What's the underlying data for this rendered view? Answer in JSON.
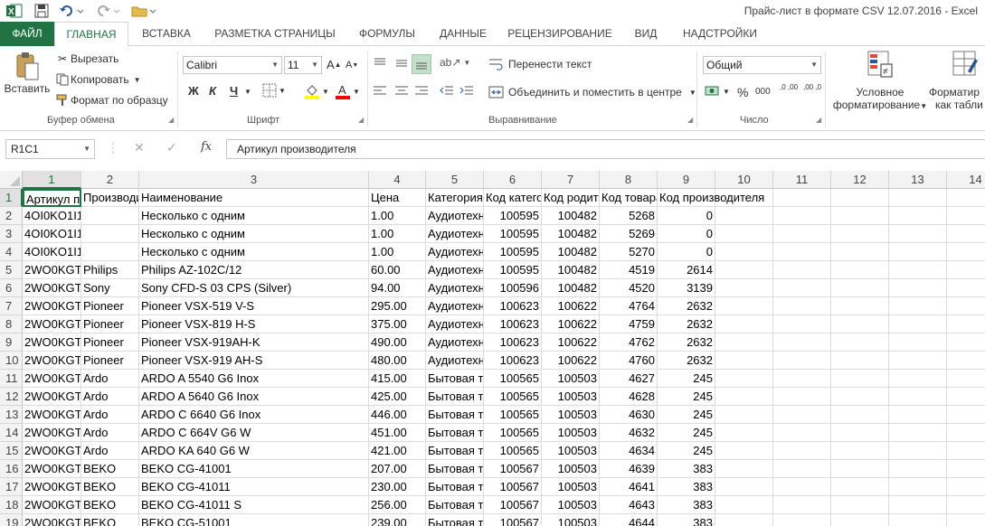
{
  "app": {
    "title": "Прайс-лист в формате CSV 12.07.2016 - Excel",
    "accent": "#217346"
  },
  "tabs": [
    "ФАЙЛ",
    "ГЛАВНАЯ",
    "ВСТАВКА",
    "РАЗМЕТКА СТРАНИЦЫ",
    "ФОРМУЛЫ",
    "ДАННЫЕ",
    "РЕЦЕНЗИРОВАНИЕ",
    "ВИД",
    "НАДСТРОЙКИ"
  ],
  "ribbon": {
    "clipboard": {
      "paste": "Вставить",
      "cut": "Вырезать",
      "copy": "Копировать",
      "format_painter": "Формат по образцу",
      "group": "Буфер обмена"
    },
    "font": {
      "name": "Calibri",
      "size": "11",
      "bold": "Ж",
      "italic": "К",
      "underline": "Ч",
      "group": "Шрифт"
    },
    "alignment": {
      "wrap_text": "Перенести текст",
      "merge_center": "Объединить и поместить в центре",
      "group": "Выравнивание"
    },
    "number": {
      "format": "Общий",
      "percent": "%",
      "thousands": "000",
      "inc_decimal": ",0 ,00",
      "dec_decimal": ",00 ,0",
      "group": "Число"
    },
    "styles": {
      "conditional": "Условное",
      "conditional2": "форматирование",
      "format_table": "Форматир",
      "format_table2": "как табли"
    }
  },
  "formula_bar": {
    "name_box": "R1C1",
    "fx": "fx",
    "cancel": "✕",
    "confirm": "✓",
    "content": "Артикул производителя"
  },
  "columns": [
    "1",
    "2",
    "3",
    "4",
    "5",
    "6",
    "7",
    "8",
    "9",
    "10",
    "11",
    "12",
    "13",
    "14"
  ],
  "rows": [
    {
      "n": "1",
      "c": [
        "Артикул пр",
        "Производит",
        "Наименование",
        "Цена",
        "Категория",
        "Код катего",
        "Код родите",
        "Код товара",
        "Код производителя"
      ]
    },
    {
      "n": "2",
      "c": [
        "4OI0KO1I1",
        "",
        "Несколько с одним",
        "1.00",
        "Аудиотехн",
        "100595",
        "100482",
        "5268",
        "0"
      ]
    },
    {
      "n": "3",
      "c": [
        "4OI0KO1I1",
        "",
        "Несколько с одним",
        "1.00",
        "Аудиотехн",
        "100595",
        "100482",
        "5269",
        "0"
      ]
    },
    {
      "n": "4",
      "c": [
        "4OI0KO1I1",
        "",
        "Несколько с одним",
        "1.00",
        "Аудиотехн",
        "100595",
        "100482",
        "5270",
        "0"
      ]
    },
    {
      "n": "5",
      "c": [
        "2WO0KGTD",
        "Philips",
        "Philips AZ-102C/12",
        "60.00",
        "Аудиотехн",
        "100595",
        "100482",
        "4519",
        "2614"
      ]
    },
    {
      "n": "6",
      "c": [
        "2WO0KGTD",
        "Sony",
        "Sony CFD-S 03 CPS (Silver)",
        "94.00",
        "Аудиотехн",
        "100596",
        "100482",
        "4520",
        "3139"
      ]
    },
    {
      "n": "7",
      "c": [
        "2WO0KGTD",
        "Pioneer",
        "Pioneer VSX-519 V-S",
        "295.00",
        "Аудиотехн",
        "100623",
        "100622",
        "4764",
        "2632"
      ]
    },
    {
      "n": "8",
      "c": [
        "2WO0KGTD",
        "Pioneer",
        "Pioneer VSX-819 H-S",
        "375.00",
        "Аудиотехн",
        "100623",
        "100622",
        "4759",
        "2632"
      ]
    },
    {
      "n": "9",
      "c": [
        "2WO0KGTD",
        "Pioneer",
        "Pioneer VSX-919AH-K",
        "490.00",
        "Аудиотехн",
        "100623",
        "100622",
        "4762",
        "2632"
      ]
    },
    {
      "n": "10",
      "c": [
        "2WO0KGTD",
        "Pioneer",
        "Pioneer VSX-919 AH-S",
        "480.00",
        "Аудиотехн",
        "100623",
        "100622",
        "4760",
        "2632"
      ]
    },
    {
      "n": "11",
      "c": [
        "2WO0KGTD",
        "Ardo",
        "ARDO A 5540 G6 Inox",
        "415.00",
        "Бытовая т",
        "100565",
        "100503",
        "4627",
        "245"
      ]
    },
    {
      "n": "12",
      "c": [
        "2WO0KGTD",
        "Ardo",
        "ARDO A 5640 G6 Inox",
        "425.00",
        "Бытовая т",
        "100565",
        "100503",
        "4628",
        "245"
      ]
    },
    {
      "n": "13",
      "c": [
        "2WO0KGTD",
        "Ardo",
        "ARDO C 6640 G6 Inox",
        "446.00",
        "Бытовая т",
        "100565",
        "100503",
        "4630",
        "245"
      ]
    },
    {
      "n": "14",
      "c": [
        "2WO0KGTD",
        "Ardo",
        "ARDO C 664V G6 W",
        "451.00",
        "Бытовая т",
        "100565",
        "100503",
        "4632",
        "245"
      ]
    },
    {
      "n": "15",
      "c": [
        "2WO0KGTD",
        "Ardo",
        "ARDO KA 640 G6 W",
        "421.00",
        "Бытовая т",
        "100565",
        "100503",
        "4634",
        "245"
      ]
    },
    {
      "n": "16",
      "c": [
        "2WO0KGTD",
        "BEKO",
        "BEKO CG-41001",
        "207.00",
        "Бытовая т",
        "100567",
        "100503",
        "4639",
        "383"
      ]
    },
    {
      "n": "17",
      "c": [
        "2WO0KGTD",
        "BEKO",
        "BEKO CG-41011",
        "230.00",
        "Бытовая т",
        "100567",
        "100503",
        "4641",
        "383"
      ]
    },
    {
      "n": "18",
      "c": [
        "2WO0KGTD",
        "BEKO",
        "BEKO CG-41011 S",
        "256.00",
        "Бытовая т",
        "100567",
        "100503",
        "4643",
        "383"
      ]
    },
    {
      "n": "19",
      "c": [
        "2WO0KGTD",
        "BEKO",
        "BEKO CG-51001",
        "239.00",
        "Бытовая т",
        "100567",
        "100503",
        "4644",
        "383"
      ]
    }
  ]
}
